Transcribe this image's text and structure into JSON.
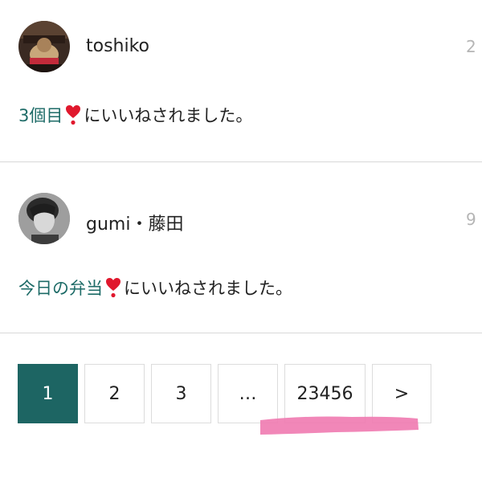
{
  "notifications": [
    {
      "username": "toshiko",
      "time": "2",
      "link_text": "3個目",
      "icon": "heart-exclamation-icon",
      "message_suffix": "にいいねされました。"
    },
    {
      "username": "gumi・藤田",
      "time": "9",
      "link_text": "今日の弁当",
      "icon": "heart-exclamation-icon",
      "message_suffix": "にいいねされました。"
    }
  ],
  "pagination": {
    "pages": [
      "1",
      "2",
      "3",
      "…",
      "23456",
      ">"
    ],
    "current": "1"
  },
  "colors": {
    "accent": "#1d6563",
    "link": "#1d6b67",
    "heart": "#e0182d",
    "marker": "#f07ab0",
    "divider": "#d8d8d8"
  }
}
